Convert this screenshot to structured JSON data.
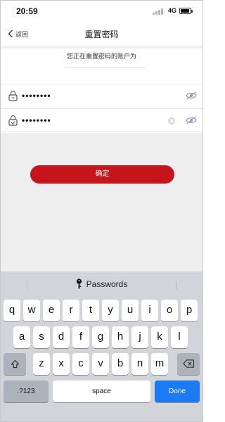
{
  "status_bar": {
    "time": "20:59",
    "network": "4G"
  },
  "nav": {
    "back_label": "返回",
    "title": "重置密码"
  },
  "info_text": "您正在重置密码的账户为",
  "fields": [
    {
      "value": "••••••••",
      "has_clear": false
    },
    {
      "value": "••••••••",
      "has_clear": true
    }
  ],
  "confirm_label": "确定",
  "keyboard": {
    "suggestion": "Passwords",
    "row1": [
      "q",
      "w",
      "e",
      "r",
      "t",
      "y",
      "u",
      "i",
      "o",
      "p"
    ],
    "row2": [
      "a",
      "s",
      "d",
      "f",
      "g",
      "h",
      "j",
      "k",
      "l"
    ],
    "row3": [
      "z",
      "x",
      "c",
      "v",
      "b",
      "n",
      "m"
    ],
    "num_label": ".?123",
    "space_label": "space",
    "done_label": "Done"
  },
  "colors": {
    "accent": "#c6141c",
    "done": "#1b7bf2",
    "keyboard_bg": "#d2d4d9"
  }
}
